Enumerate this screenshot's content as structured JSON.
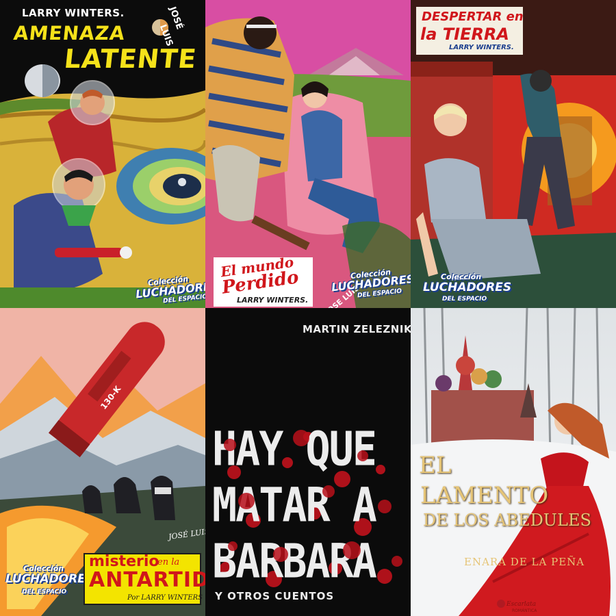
{
  "covers": [
    {
      "author": "LARRY WINTERS.",
      "title_line1": "AMENAZA",
      "title_line2": "LATENTE",
      "artist_line1": "JOSÉ",
      "artist_line2": "LUIS",
      "series_line1": "Colección",
      "series_line2": "LUCHADORES",
      "series_line3": "DEL ESPACIO"
    },
    {
      "title_line1": "El mundo",
      "title_line2": "Perdido",
      "author": "LARRY WINTERS.",
      "artist": "JOSE LUIS",
      "series_line1": "Colección",
      "series_line2": "LUCHADORES",
      "series_line3": "DEL ESPACIO"
    },
    {
      "title_line1": "DESPERTAR en",
      "title_line2": "la TIERRA",
      "author": "LARRY WINTERS.",
      "series_line1": "Colección",
      "series_line2": "LUCHADORES",
      "series_line3": "DEL ESPACIO"
    },
    {
      "rocket_label": "130-K",
      "artist": "JOSÉ LUIS",
      "series_line1": "Colección",
      "series_line2": "LUCHADORES",
      "series_line3": "DEL ESPACIO",
      "title_line1": "misterio",
      "title_line1b": "en la",
      "title_line2": "ANTARTIDA",
      "author": "Por LARRY WINTERS"
    },
    {
      "author": "MARTIN ZELEZNIK",
      "title_line1": "HAY QUE",
      "title_line2": "MATAR A",
      "title_line3": "BARBARA",
      "subtitle": "Y OTROS CUENTOS"
    },
    {
      "title_line1": "EL",
      "title_line2": "LAMENTO",
      "title_line3": "DE LOS ABEDULES",
      "author": "ENARA DE LA PEÑA",
      "publisher": "Escarlata",
      "publisher_sub": "ROMÁNTICA"
    }
  ]
}
